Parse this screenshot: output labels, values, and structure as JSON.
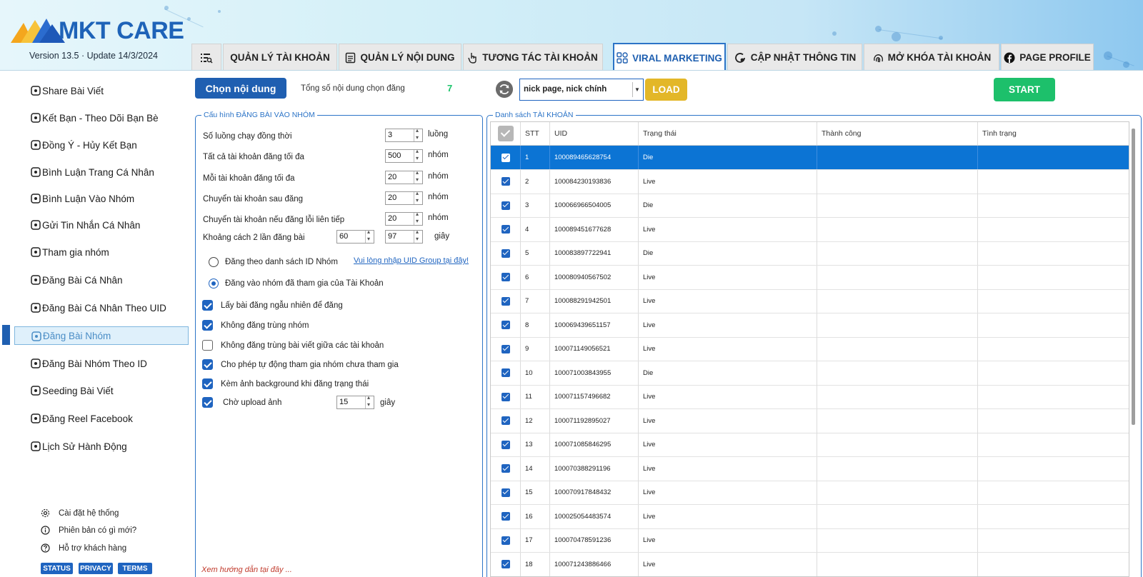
{
  "app": {
    "logo_text": "MKT CARE",
    "version": "Version  13.5 · Update  14/3/2024"
  },
  "tabs": [
    {
      "label": "",
      "icon": "list-search-icon"
    },
    {
      "label": "QUẢN LÝ TÀI KHOẢN",
      "icon": ""
    },
    {
      "label": "QUẢN LÝ NỘI DUNG",
      "icon": "document-icon"
    },
    {
      "label": "TƯƠNG TÁC TÀI KHOẢN",
      "icon": "hand-pointer-icon"
    },
    {
      "label": "VIRAL MARKETING",
      "icon": "grid-icon",
      "active": true
    },
    {
      "label": "CẬP NHẬT THÔNG TIN",
      "icon": "refresh-user-icon"
    },
    {
      "label": "MỞ KHÓA TÀI KHOẢN",
      "icon": "fingerprint-icon"
    },
    {
      "label": "PAGE PROFILE",
      "icon": "facebook-icon"
    }
  ],
  "sidebar": {
    "items": [
      {
        "label": "Share Bài Viết",
        "icon": "share-arrows-icon"
      },
      {
        "label": "Kết Bạn - Theo Dõi Bạn Bè",
        "icon": "heart-link-icon"
      },
      {
        "label": "Đồng Ý - Hủy Kết Bạn",
        "icon": "check-badge-icon"
      },
      {
        "label": "Bình Luận Trang Cá Nhân",
        "icon": "user-card-icon"
      },
      {
        "label": "Bình Luận Vào Nhóm",
        "icon": "chat-bubble-icon"
      },
      {
        "label": "Gửi Tin Nhắn Cá Nhân",
        "icon": "mail-icon"
      },
      {
        "label": "Tham gia nhóm",
        "icon": "group-card-icon"
      },
      {
        "label": "Đăng Bài Cá Nhân",
        "icon": "cloud-upload-icon"
      },
      {
        "label": "Đăng Bài Cá Nhân Theo UID",
        "icon": "cloud-upload-icon"
      },
      {
        "label": "Đăng Bài Nhóm",
        "icon": "cloud-search-icon",
        "active": true
      },
      {
        "label": "Đăng Bài Nhóm Theo ID",
        "icon": "cloud-search-icon"
      },
      {
        "label": "Seeding Bài Viết",
        "icon": "seeding-icon"
      },
      {
        "label": "Đăng Reel Facebook",
        "icon": "reel-icon"
      },
      {
        "label": "Lịch Sử Hành Động",
        "icon": "history-icon"
      }
    ],
    "footer": [
      {
        "label": "Cài đặt hệ thống",
        "icon": "gear-icon"
      },
      {
        "label": "Phiên bản có gì mới?",
        "icon": "info-icon"
      },
      {
        "label": "Hỗ trợ khách hàng",
        "icon": "help-icon"
      }
    ],
    "footer_buttons": [
      "STATUS",
      "PRIVACY",
      "TERMS"
    ]
  },
  "toolbar": {
    "choose_content": "Chọn nội dung",
    "total_label": "Tổng số nội dung chọn đăng",
    "total_count": "7",
    "account_select": "nick page, nick chính",
    "load": "LOAD",
    "start": "START"
  },
  "config": {
    "title": "Cấu hình ĐĂNG BÀI VÀO NHÓM",
    "fields": [
      {
        "label": "Số luồng chạy đồng thời",
        "value": "3",
        "unit": "luồng"
      },
      {
        "label": "Tất cả tài khoản đăng tối đa",
        "value": "500",
        "unit": "nhóm"
      },
      {
        "label": "Mỗi tài khoản đăng tối đa",
        "value": "20",
        "unit": "nhóm"
      },
      {
        "label": "Chuyển tài khoản sau đăng",
        "value": "20",
        "unit": "nhóm"
      },
      {
        "label": "Chuyển tài khoản nếu đăng lỗi liên tiếp",
        "value": "20",
        "unit": "nhóm"
      }
    ],
    "interval": {
      "label": "Khoảng cách 2 lần đăng bài",
      "min": "60",
      "max": "97",
      "unit": "giây"
    },
    "radios": [
      {
        "label": "Đăng theo danh sách ID Nhóm",
        "checked": false
      },
      {
        "label": "Đăng vào nhóm đã tham gia của Tài Khoản",
        "checked": true
      }
    ],
    "uid_link": "Vui lòng nhập UID Group tại đây!",
    "checkboxes": [
      {
        "label": "Lấy bài đăng ngẫu nhiên để đăng",
        "checked": true
      },
      {
        "label": "Không đăng trùng nhóm",
        "checked": true
      },
      {
        "label": "Không đăng trùng bài viết giữa các tài khoản",
        "checked": false
      },
      {
        "label": "Cho phép tự động tham gia nhóm chưa tham gia",
        "checked": true
      },
      {
        "label": "Kèm ảnh background khi đăng trạng thái",
        "checked": true
      },
      {
        "label": "Chờ upload ảnh",
        "checked": true
      }
    ],
    "upload_wait": {
      "value": "15",
      "unit": "giây"
    },
    "guide": "Xem hướng dẫn tại đây ..."
  },
  "accounts": {
    "title": "Danh sách TÀI KHOẢN",
    "columns": [
      "",
      "STT",
      "UID",
      "Trạng thái",
      "Thành công",
      "Tình trạng"
    ],
    "rows": [
      {
        "stt": "1",
        "uid": "100089465628754",
        "status": "Die",
        "selected": true
      },
      {
        "stt": "2",
        "uid": "100084230193836",
        "status": "Live"
      },
      {
        "stt": "3",
        "uid": "100066966504005",
        "status": "Die"
      },
      {
        "stt": "4",
        "uid": "100089451677628",
        "status": "Live"
      },
      {
        "stt": "5",
        "uid": "100083897722941",
        "status": "Die"
      },
      {
        "stt": "6",
        "uid": "100080940567502",
        "status": "Live"
      },
      {
        "stt": "7",
        "uid": "100088291942501",
        "status": "Live"
      },
      {
        "stt": "8",
        "uid": "100069439651157",
        "status": "Live"
      },
      {
        "stt": "9",
        "uid": "100071149056521",
        "status": "Live"
      },
      {
        "stt": "10",
        "uid": "100071003843955",
        "status": "Die"
      },
      {
        "stt": "11",
        "uid": "100071157496682",
        "status": "Live"
      },
      {
        "stt": "12",
        "uid": "100071192895027",
        "status": "Live"
      },
      {
        "stt": "13",
        "uid": "100071085846295",
        "status": "Live"
      },
      {
        "stt": "14",
        "uid": "100070388291196",
        "status": "Live"
      },
      {
        "stt": "15",
        "uid": "100070917848432",
        "status": "Live"
      },
      {
        "stt": "16",
        "uid": "100025054483574",
        "status": "Live"
      },
      {
        "stt": "17",
        "uid": "100070478591236",
        "status": "Live"
      },
      {
        "stt": "18",
        "uid": "100071243886466",
        "status": "Live"
      }
    ]
  },
  "colors": {
    "primary": "#1f5fb1",
    "start": "#1dc06b",
    "load": "#e3b728",
    "selected_row": "#0c74d4"
  }
}
